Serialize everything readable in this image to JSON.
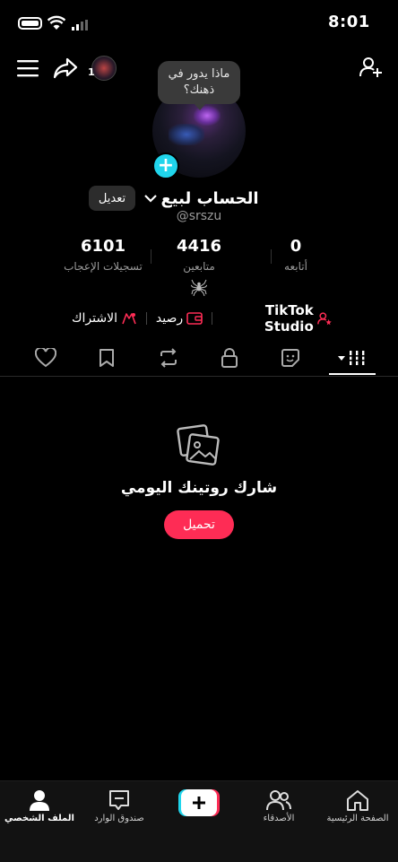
{
  "status_bar": {
    "time": "8:01"
  },
  "top_bar": {
    "notification_count": "1"
  },
  "profile": {
    "thought_bubble": "ماذا يدور في ذهنك؟",
    "display_name": "الحساب لبيع",
    "username": "@srszu",
    "edit_button_label": "تعديل",
    "stats": [
      {
        "value": "0",
        "label": "أتابعه"
      },
      {
        "value": "4416",
        "label": "متابعين"
      },
      {
        "value": "6101",
        "label": "تسجيلات الإعجاب"
      }
    ],
    "bio_icon": "spider-icon"
  },
  "tools": {
    "studio_label": "TikTok Studio",
    "balance_label": "رصيد",
    "subscription_label": "الاشتراك"
  },
  "content_tabs": {
    "icons": [
      "grid-icon",
      "story-icon",
      "lock-icon",
      "repost-icon",
      "bookmark-icon",
      "heart-icon"
    ],
    "active": "grid-icon"
  },
  "empty_state": {
    "title": "شارك روتينك اليومي",
    "button_label": "تحميل"
  },
  "bottom_nav": {
    "home": "الصفحة الرئيسية",
    "friends": "الأصدقاء",
    "inbox": "صندوق الوارد",
    "profile": "الملف الشخصي"
  },
  "colors": {
    "accent": "#fe2c55",
    "cyan": "#20d5ec",
    "background": "#000000"
  }
}
